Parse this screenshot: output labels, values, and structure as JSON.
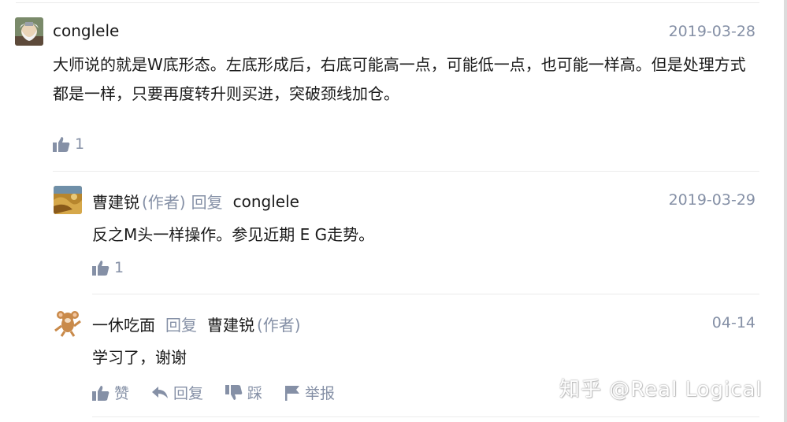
{
  "comments": [
    {
      "author": "conglele",
      "date": "2019-03-28",
      "content": "大师说的就是W底形态。左底形成后，右底可能高一点，可能低一点，也可能一样高。但是处理方式都是一样，只要再度转升则买进，突破颈线加仓。",
      "likes": "1"
    }
  ],
  "replies": [
    {
      "author": "曹建锐",
      "author_tag": "(作者)",
      "reply_word": "回复",
      "reply_to": "conglele",
      "reply_to_tag": "",
      "date": "2019-03-29",
      "content": "反之M头一样操作。参见近期 E G走势。",
      "likes": "1"
    },
    {
      "author": "一休吃面",
      "author_tag": "",
      "reply_word": "回复",
      "reply_to": "曹建锐",
      "reply_to_tag": "(作者)",
      "date": "04-14",
      "content": "学习了，谢谢",
      "actions": {
        "like": "赞",
        "reply": "回复",
        "dislike": "踩",
        "report": "举报"
      }
    }
  ],
  "watermark": "知乎 @Real Logical",
  "colors": {
    "meta": "#8590a6",
    "text": "#1a1a1a",
    "divider": "#ebebeb"
  },
  "icons": [
    "thumbs-up-icon",
    "reply-arrow-icon",
    "thumbs-down-icon",
    "flag-icon"
  ]
}
